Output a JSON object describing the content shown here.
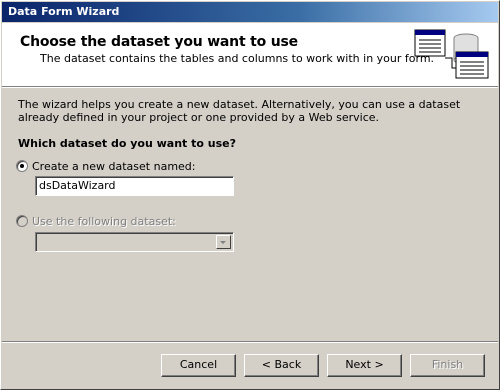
{
  "window": {
    "title": "Data Form Wizard"
  },
  "header": {
    "heading": "Choose the dataset you want to use",
    "subheading": "The dataset contains the tables and columns to work with in your form."
  },
  "body": {
    "intro": "The wizard helps you create a new dataset. Alternatively, you can use a dataset already defined in your project or one provided by a Web service.",
    "question": "Which dataset do you want to use?",
    "option_new": {
      "label": "Create a new dataset named:",
      "selected": true,
      "value": "dsDataWizard"
    },
    "option_existing": {
      "label": "Use the following dataset:",
      "selected": false,
      "enabled": false,
      "value": ""
    }
  },
  "buttons": {
    "cancel": "Cancel",
    "back": "< Back",
    "next": "Next >",
    "finish": "Finish"
  }
}
